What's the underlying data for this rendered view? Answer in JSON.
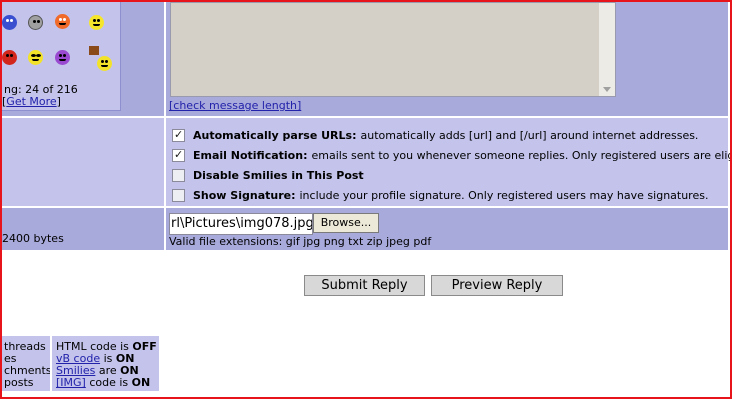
{
  "smilies": {
    "showing_text": "ng: 24 of 216",
    "get_more_open": "[",
    "get_more_label": "Get More",
    "get_more_close": "]",
    "icons": [
      "blue-face-icon",
      "gray-face-icon",
      "red-angry-face-icon",
      "yellow-face-icon",
      "red-mad-face-icon",
      "sunglasses-face-icon",
      "purple-face-icon",
      "sign-face-icon"
    ]
  },
  "message": {
    "check_length_label": "[check message length]"
  },
  "options": [
    {
      "checked": true,
      "label": "Automatically parse URLs:",
      "desc": "automatically adds [url] and [/url] around internet addresses."
    },
    {
      "checked": true,
      "label": "Email Notification:",
      "desc": "emails sent to you whenever someone replies. Only registered users are elig"
    },
    {
      "checked": false,
      "label": "Disable Smilies in This Post",
      "desc": ""
    },
    {
      "checked": false,
      "label": "Show Signature:",
      "desc": "include your profile signature. Only registered users may have signatures."
    }
  ],
  "attachment": {
    "max_size_text": "2400 bytes",
    "file_path_value": "rl\\Pictures\\img078.jpg",
    "browse_label": "Browse...",
    "extensions_text": "Valid file extensions: gif jpg png txt zip jpeg pdf"
  },
  "buttons": {
    "submit_label": "Submit Reply",
    "preview_label": "Preview Reply"
  },
  "rules": {
    "left_lines": [
      "threads",
      "es",
      "chments",
      "posts"
    ],
    "html_prefix": "HTML code is ",
    "html_state": "OFF",
    "vb_link": "vB code",
    "vb_suffix": " is ",
    "vb_state": "ON",
    "smilies_link": "Smilies",
    "smilies_suffix": " are ",
    "smilies_state": "ON",
    "img_link": "[IMG]",
    "img_suffix": " code is ",
    "img_state": "ON"
  },
  "colors": {
    "row_dark": "#a9aadc",
    "row_light": "#c3c3ec",
    "frame_border": "#e8141c",
    "link": "#2222aa"
  }
}
